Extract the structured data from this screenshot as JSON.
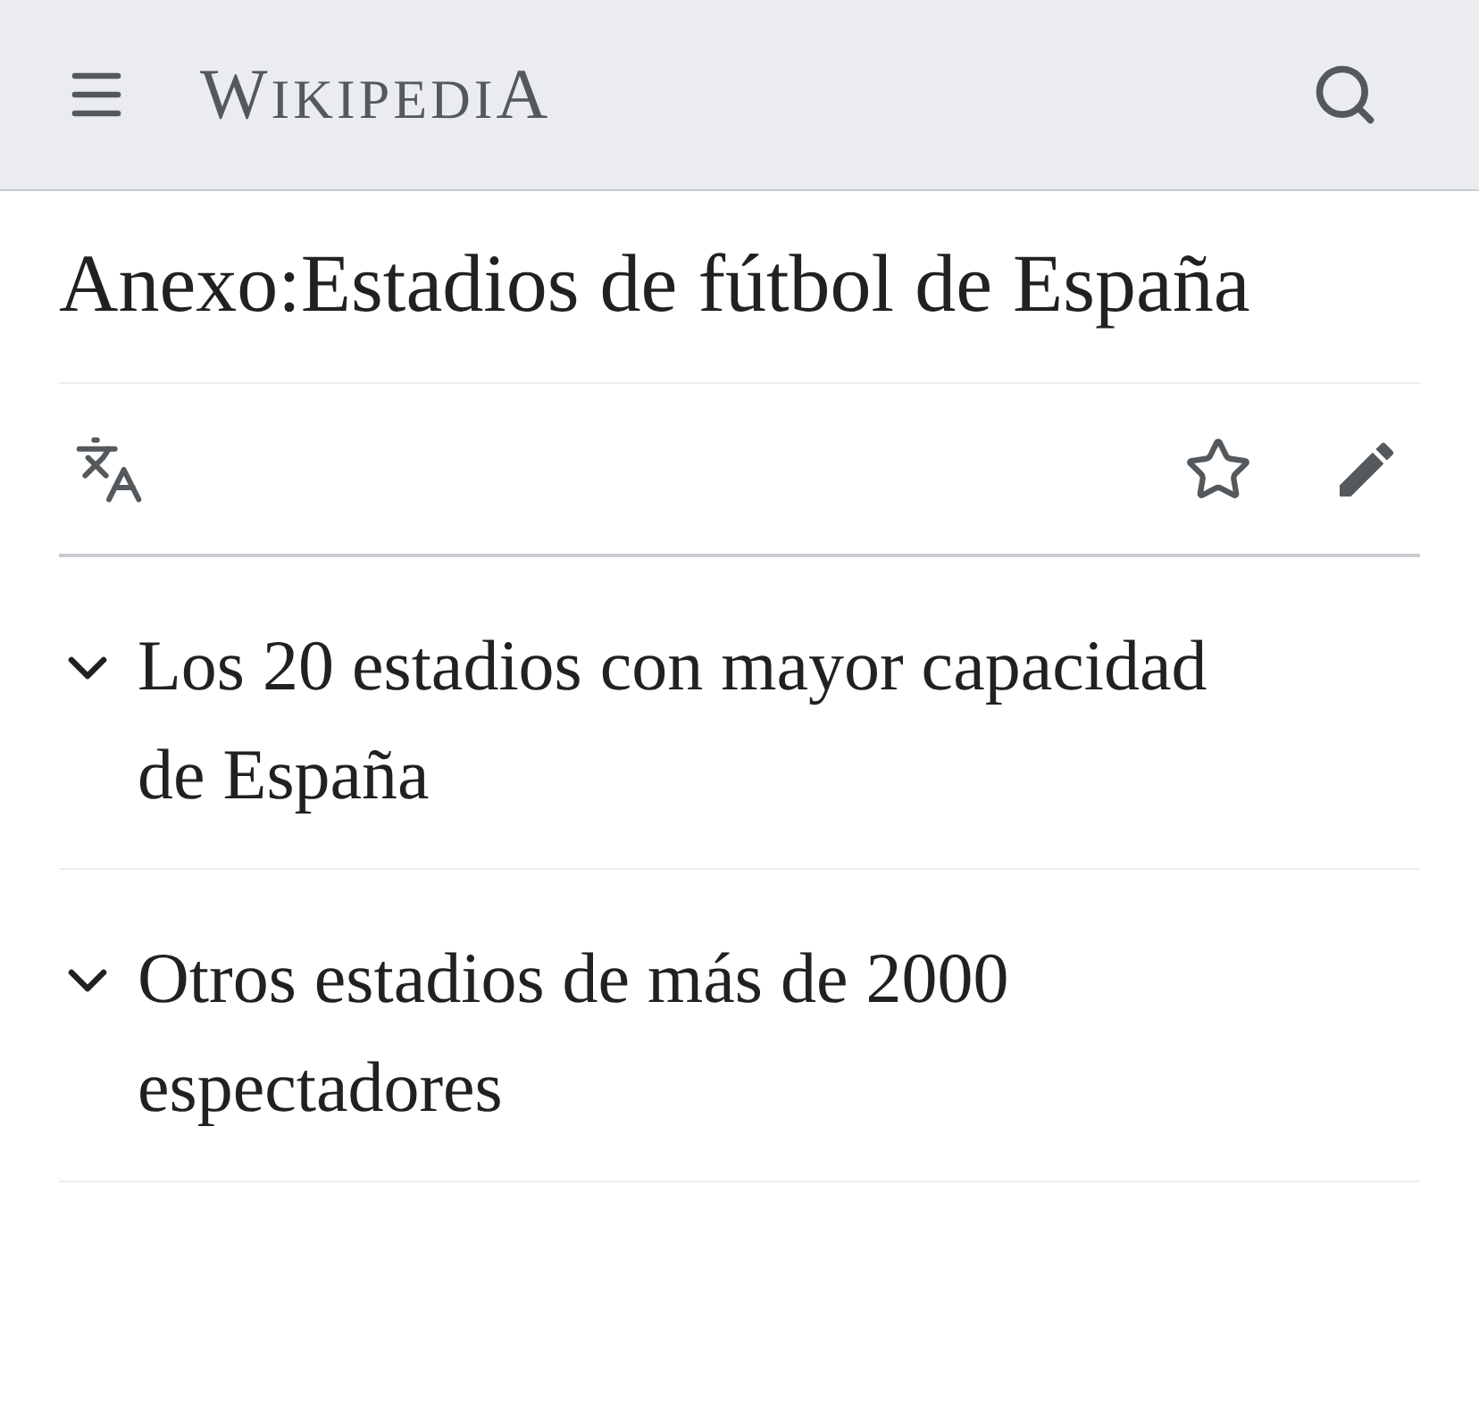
{
  "header": {
    "logo": "WIKIPEDIA"
  },
  "page": {
    "title": "Anexo:Estadios de fútbol de España"
  },
  "sections": [
    {
      "title": "Los 20 estadios con mayor capacidad de España",
      "expanded": false
    },
    {
      "title": "Otros estadios de más de 2000 espectadores",
      "expanded": false
    }
  ]
}
